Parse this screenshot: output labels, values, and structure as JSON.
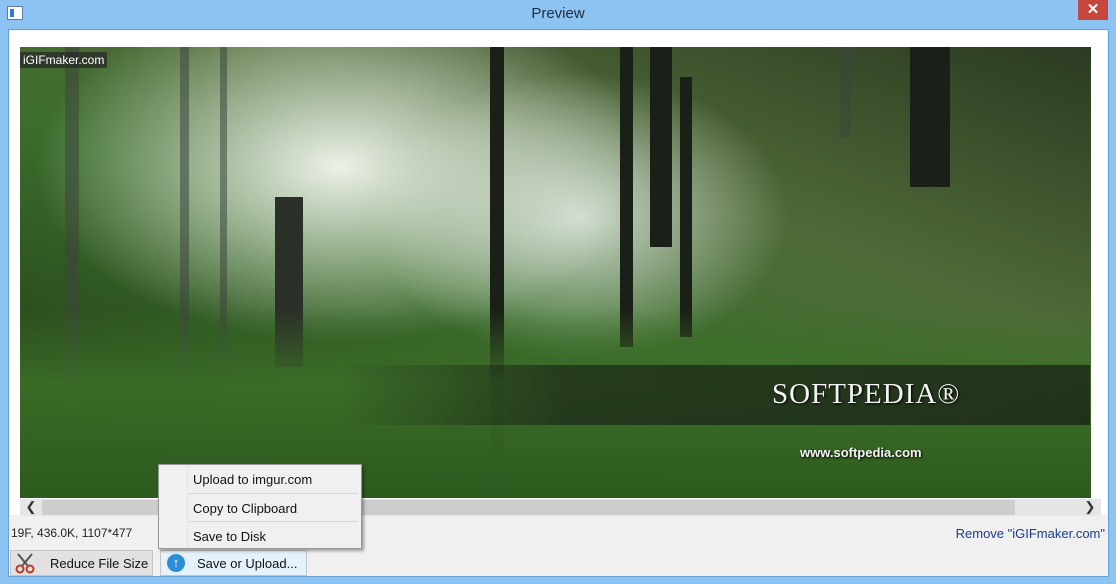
{
  "window": {
    "title": "Preview",
    "close_glyph": "✕"
  },
  "preview": {
    "watermark_tag": "iGIFmaker.com",
    "overlay_logo": "SOFTPEDIA®",
    "overlay_url": "www.softpedia.com"
  },
  "scrollbar": {
    "left_arrow": "❮",
    "right_arrow": "❯"
  },
  "status": {
    "info": "19F, 436.0K, 1107*477",
    "remove_link": "Remove \"iGIFmaker.com\""
  },
  "toolbar": {
    "reduce_label": "Reduce File Size",
    "upload_label": "Save or Upload..."
  },
  "context_menu": {
    "items": [
      {
        "label": "Upload to imgur.com"
      },
      {
        "label": "Copy to Clipboard"
      },
      {
        "label": "Save to Disk"
      }
    ]
  },
  "colors": {
    "titlebar": "#8cc3f3",
    "close_button": "#c7463c",
    "link": "#1a3c8c"
  },
  "icons": [
    "app-window-icon",
    "close-icon",
    "scissors-icon",
    "upload-arrow-icon",
    "chevron-left-icon",
    "chevron-right-icon"
  ]
}
